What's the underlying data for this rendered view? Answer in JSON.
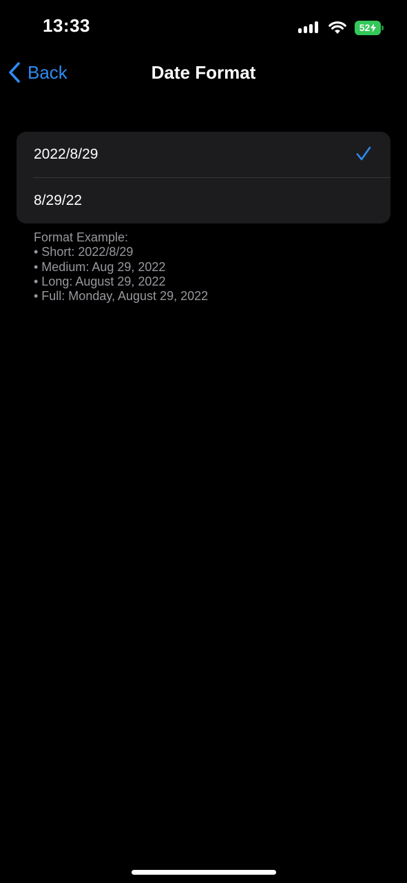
{
  "status_bar": {
    "time": "13:33",
    "battery_level": "52",
    "battery_charging": true,
    "battery_color": "#34c759",
    "icons": [
      "signal-icon",
      "wifi-icon",
      "battery-icon"
    ]
  },
  "nav": {
    "back_label": "Back",
    "title": "Date Format",
    "accent_color": "#2f8bf0"
  },
  "formats": {
    "options": [
      {
        "label": "2022/8/29",
        "selected": true
      },
      {
        "label": "8/29/22",
        "selected": false
      }
    ]
  },
  "footer": {
    "heading": "Format Example:",
    "lines": [
      "• Short: 2022/8/29",
      "• Medium: Aug 29, 2022",
      "• Long: August 29, 2022",
      "• Full: Monday, August 29, 2022"
    ]
  }
}
